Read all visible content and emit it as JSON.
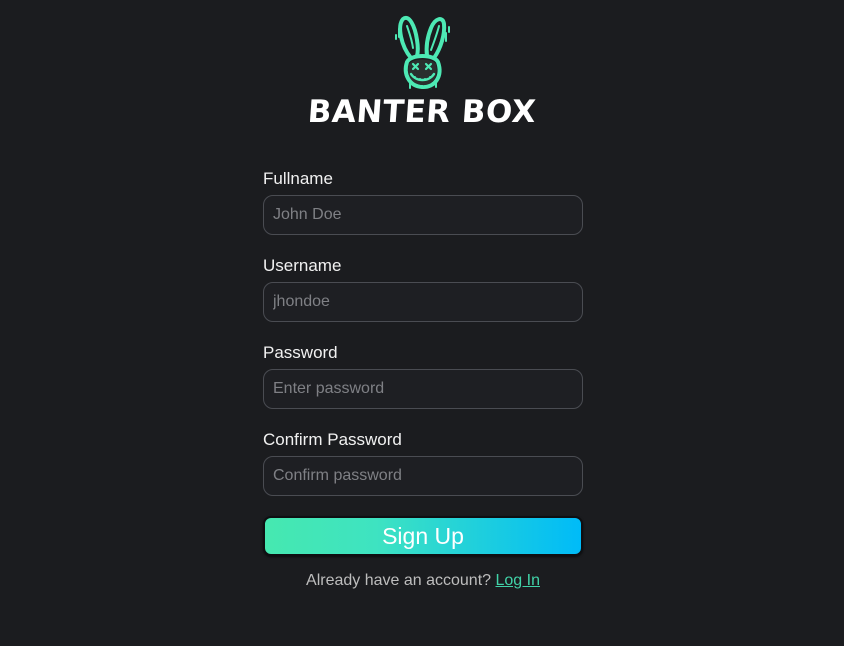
{
  "brand": {
    "name": "BANTER BOX",
    "logo_icon": "bunny-icon",
    "accent_color": "#4de9b4"
  },
  "form": {
    "fields": [
      {
        "label": "Fullname",
        "placeholder": "John Doe",
        "value": ""
      },
      {
        "label": "Username",
        "placeholder": "jhondoe",
        "value": ""
      },
      {
        "label": "Password",
        "placeholder": "Enter password",
        "value": ""
      },
      {
        "label": "Confirm Password",
        "placeholder": "Confirm password",
        "value": ""
      }
    ],
    "submit_label": "Sign Up",
    "submit_gradient": [
      "#46e8b0",
      "#00bbf8"
    ]
  },
  "footer": {
    "prompt": "Already have an account?",
    "link_label": "Log In",
    "link_color": "#41d3a8"
  }
}
